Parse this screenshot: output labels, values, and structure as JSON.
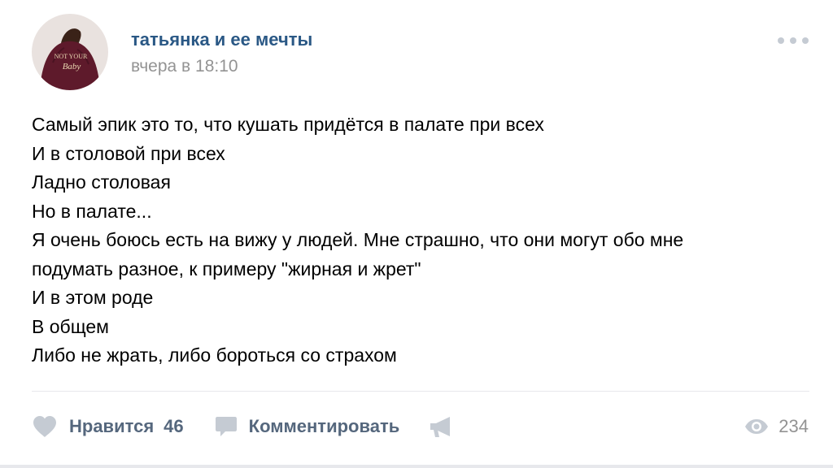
{
  "post": {
    "author": "татьянка и ее мечты",
    "timestamp": "вчера в 18:10",
    "avatar_text_line1": "NOT YOUR",
    "avatar_text_line2": "Baby",
    "lines": [
      "Самый эпик это то, что кушать придётся в палате при всех",
      "И в столовой при всех",
      "Ладно столовая",
      "Но в палате...",
      "Я очень боюсь есть на вижу у людей. Мне страшно, что они могут обо мне",
      "подумать разное, к примеру \"жирная и жрет\"",
      "И в этом роде",
      "В общем",
      "Либо не жрать, либо бороться со страхом"
    ]
  },
  "actions": {
    "like_label": "Нравится",
    "like_count": "46",
    "comment_label": "Комментировать",
    "views_count": "234"
  },
  "icons": {
    "more": "more-dots-icon",
    "like": "heart-icon",
    "comment": "comment-bubble-icon",
    "share": "megaphone-share-icon",
    "views": "eye-icon"
  },
  "colors": {
    "author": "#2a5885",
    "action": "#55677d",
    "muted": "#939393",
    "icon": "#c5cbd3"
  }
}
